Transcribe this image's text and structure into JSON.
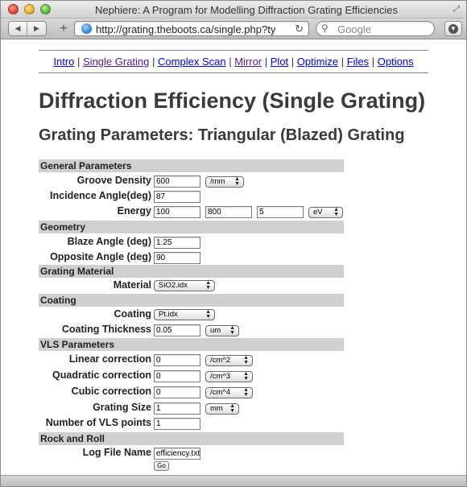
{
  "window": {
    "title": "Nephiere: A Program for Modelling Diffraction Grating Efficiencies"
  },
  "toolbar": {
    "url": "http://grating.theboots.ca/single.php?ty",
    "search_placeholder": "Google"
  },
  "nav": {
    "links": [
      "Intro",
      "Single Grating",
      "Complex Scan",
      "Mirror",
      "Plot",
      "Optimize",
      "Files",
      "Options"
    ],
    "separator": " | "
  },
  "page": {
    "title": "Diffraction Efficiency (Single Grating)",
    "subtitle": "Grating Parameters: Triangular (Blazed) Grating"
  },
  "form": {
    "general": {
      "heading": "General Parameters",
      "groove_density_label": "Groove Density",
      "groove_density_value": "600",
      "groove_density_unit": "/mm",
      "incidence_label": "Incidence Angle(deg)",
      "incidence_value": "87",
      "energy_label": "Energy",
      "energy_start": "100",
      "energy_end": "800",
      "energy_step": "5",
      "energy_unit": "eV"
    },
    "geometry": {
      "heading": "Geometry",
      "blaze_label": "Blaze Angle (deg)",
      "blaze_value": "1.25",
      "opposite_label": "Opposite Angle (deg)",
      "opposite_value": "90"
    },
    "material": {
      "heading": "Grating Material",
      "material_label": "Material",
      "material_value": "SiO2.idx"
    },
    "coating": {
      "heading": "Coating",
      "coating_label": "Coating",
      "coating_value": "Pt.idx",
      "thickness_label": "Coating Thickness",
      "thickness_value": "0.05",
      "thickness_unit": "um"
    },
    "vls": {
      "heading": "VLS Parameters",
      "linear_label": "Linear correction",
      "linear_value": "0",
      "linear_unit": "/cm^2",
      "quadratic_label": "Quadratic correction",
      "quadratic_value": "0",
      "quadratic_unit": "/cm^3",
      "cubic_label": "Cubic correction",
      "cubic_value": "0",
      "cubic_unit": "/cm^4",
      "size_label": "Grating Size",
      "size_value": "1",
      "size_unit": "mm",
      "points_label": "Number of VLS points",
      "points_value": "1"
    },
    "rock": {
      "heading": "Rock and Roll",
      "logfile_label": "Log File Name",
      "logfile_value": "efficiency.txt",
      "go_label": "Go"
    }
  }
}
